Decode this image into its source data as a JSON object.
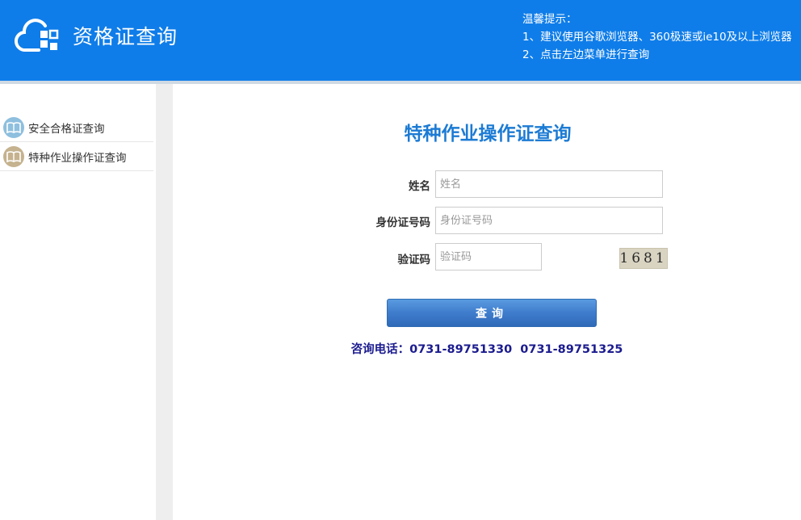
{
  "header": {
    "title": "资格证查询",
    "tips": {
      "heading": "温馨提示：",
      "line1": "1、建议使用谷歌浏览器、360极速或ie10及以上浏览器",
      "line2": "2、点击左边菜单进行查询"
    }
  },
  "sidebar": {
    "items": [
      {
        "label": "安全合格证查询",
        "icon": "book-icon",
        "color": "#8ebfde"
      },
      {
        "label": "特种作业操作证查询",
        "icon": "book-icon",
        "color": "#c5b28e"
      }
    ]
  },
  "form": {
    "title": "特种作业操作证查询",
    "name_label": "姓名",
    "name_placeholder": "姓名",
    "id_label": "身份证号码",
    "id_placeholder": "身份证号码",
    "captcha_label": "验证码",
    "captcha_placeholder": "验证码",
    "captcha_text": "1681",
    "submit_label": "查询",
    "contact": "咨询电话：0731-89751330  0731-89751325"
  },
  "colors": {
    "header_bg": "#0f7de9",
    "title_blue": "#1c7bd4",
    "contact_navy": "#1b1b8f"
  }
}
